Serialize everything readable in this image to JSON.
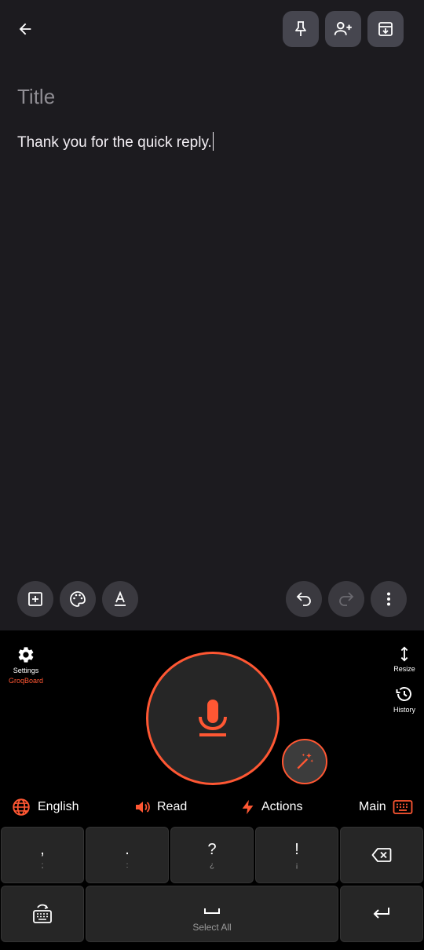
{
  "note": {
    "title_placeholder": "Title",
    "body_text": "Thank you for the quick reply."
  },
  "keyboard": {
    "settings_label": "Settings",
    "brand_label": "GroqBoard",
    "resize_label": "Resize",
    "history_label": "History",
    "language_label": "English",
    "read_label": "Read",
    "actions_label": "Actions",
    "main_label": "Main",
    "keys": [
      {
        "main": ",",
        "alt": ";"
      },
      {
        "main": ".",
        "alt": ":"
      },
      {
        "main": "?",
        "alt": "¿"
      },
      {
        "main": "!",
        "alt": "¡"
      }
    ],
    "space_hint": "Select All"
  },
  "colors": {
    "accent": "#ff5733",
    "note_background": "#1c1b1f",
    "keyboard_background": "#000000",
    "key_background": "#262626"
  }
}
